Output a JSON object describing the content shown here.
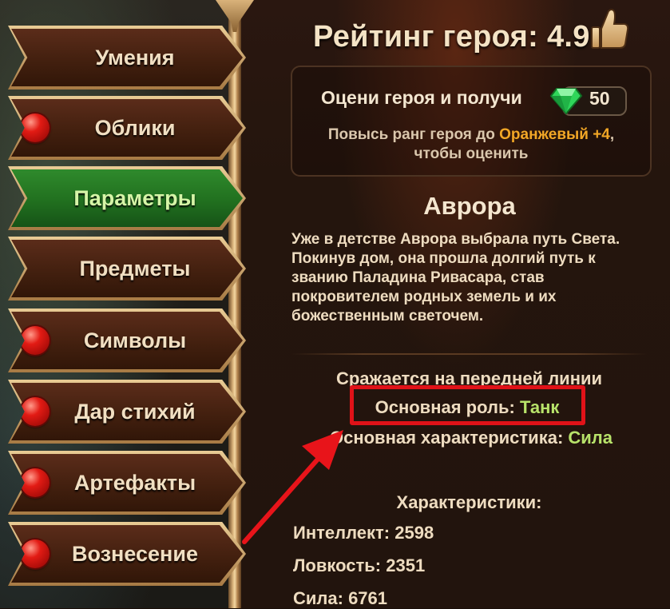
{
  "nav": {
    "tabs": [
      {
        "label": "Умения",
        "badge": false,
        "active": false
      },
      {
        "label": "Облики",
        "badge": true,
        "active": false
      },
      {
        "label": "Параметры",
        "badge": false,
        "active": true
      },
      {
        "label": "Предметы",
        "badge": false,
        "active": false
      },
      {
        "label": "Символы",
        "badge": true,
        "active": false
      },
      {
        "label": "Дар стихий",
        "badge": true,
        "active": false
      },
      {
        "label": "Артефакты",
        "badge": true,
        "active": false
      },
      {
        "label": "Вознесение",
        "badge": true,
        "active": false
      }
    ]
  },
  "rating": {
    "title": "Рейтинг героя: 4.9",
    "icon": "thumbs-up-icon"
  },
  "reward": {
    "prompt": "Оцени героя и получи",
    "gem_amount": "50",
    "gem_icon": "emerald-gem-icon",
    "req_prefix": "Повысь ранг героя до ",
    "req_rank": "Оранжевый +4",
    "req_suffix": ",",
    "req_line2": "чтобы оценить"
  },
  "hero": {
    "name": "Аврора",
    "description": "Уже в детстве Аврора выбрала путь Света. Покинув дом, она прошла долгий путь к званию Паладина Ривасара, став покровителем родных земель и их божественным светочем.",
    "position": "Сражается на передней линии",
    "role_label": "Основная роль: ",
    "role_value": "Танк",
    "main_stat_label": "Основная характеристика: ",
    "main_stat_value": "Сила"
  },
  "stats": {
    "header": "Характеристики:",
    "items": [
      {
        "label": "Интеллект: ",
        "value": "2598"
      },
      {
        "label": "Ловкость: ",
        "value": "2351"
      },
      {
        "label": "Сила: ",
        "value": "6761"
      }
    ]
  },
  "colors": {
    "highlight": "#e01218",
    "accent_green": "#b8e36a",
    "accent_orange": "#f2a726",
    "active_tab": "#2f8a2c"
  }
}
